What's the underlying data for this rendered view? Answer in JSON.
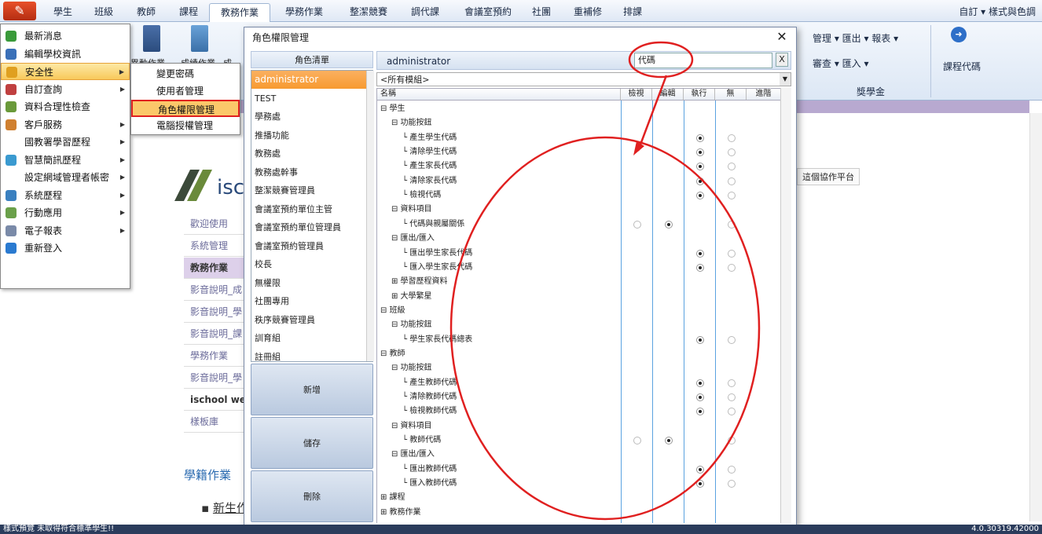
{
  "menubar": {
    "tabs": [
      "學生",
      "班級",
      "教師",
      "課程",
      "教務作業",
      "學務作業",
      "整潔競賽",
      "調代課",
      "會議室預約",
      "社團",
      "重補修",
      "排課"
    ],
    "active_tab": "教務作業",
    "right": "自訂 ▾ 樣式與色調"
  },
  "ribbon": {
    "left_labels": [
      "異動作業",
      "成績作業",
      "成"
    ],
    "right_group": {
      "row1": "管理 ▾ 匯出 ▾ 報表 ▾",
      "row2": "審查 ▾ 匯入 ▾",
      "group_label": "獎學金",
      "course_code": "課程代碼"
    }
  },
  "left_menu": [
    {
      "label": "最新消息",
      "icon": "speech-icon",
      "arrow": false
    },
    {
      "label": "編輯學校資訊",
      "icon": "school-icon",
      "arrow": false
    },
    {
      "label": "安全性",
      "icon": "key-icon",
      "arrow": true,
      "highlight": true
    },
    {
      "label": "自訂查詢",
      "icon": "query-icon",
      "arrow": true
    },
    {
      "label": "資料合理性檢查",
      "icon": "check-icon",
      "arrow": false
    },
    {
      "label": "客戶服務",
      "icon": "person-icon",
      "arrow": true
    },
    {
      "label": "國教署學習歷程",
      "icon": "",
      "arrow": true
    },
    {
      "label": "智慧簡訊歷程",
      "icon": "sms-icon",
      "arrow": true
    },
    {
      "label": "設定網域管理者帳密",
      "icon": "",
      "arrow": true
    },
    {
      "label": "系統歷程",
      "icon": "history-icon",
      "arrow": true
    },
    {
      "label": "行動應用",
      "icon": "mobile-icon",
      "arrow": true
    },
    {
      "label": "電子報表",
      "icon": "report-icon",
      "arrow": true
    },
    {
      "label": "重新登入",
      "icon": "relogin-icon",
      "arrow": false
    }
  ],
  "submenu": [
    "變更密碼",
    "使用者管理",
    "角色權限管理",
    "電腦授權管理"
  ],
  "page": {
    "logo_text": "isc",
    "rows": [
      "歡迎使用",
      "系統管理",
      "教務作業",
      "影音說明_成",
      "影音說明_學",
      "影音說明_課",
      "學務作業",
      "影音說明_學",
      "ischool wel",
      "樣板庫"
    ],
    "section_title": "學籍作業",
    "bullet": "新生作",
    "platform_btn": "這個協作平台"
  },
  "dialog": {
    "title": "角色權限管理",
    "role_header": "角色清單",
    "roles": [
      "administrator",
      "TEST",
      "學務處",
      "推播功能",
      "教務處",
      "教務處幹事",
      "整潔競賽管理員",
      "會議室預約單位主管",
      "會議室預約單位管理員",
      "會議室預約管理員",
      "校長",
      "無權限",
      "社團專用",
      "秩序競賽管理員",
      "訓育組",
      "註冊組"
    ],
    "selected_role": "administrator",
    "buttons": {
      "add": "新增",
      "save": "儲存",
      "delete": "刪除"
    },
    "admin_title": "administrator",
    "search_value": "代碼",
    "search_clear": "X",
    "module_select": "<所有模組>",
    "columns": [
      "名稱",
      "檢視",
      "編輯",
      "執行",
      "無",
      "進階"
    ],
    "tree": [
      {
        "label": "學生",
        "level": 0,
        "sign": "⊟"
      },
      {
        "label": "功能按鈕",
        "level": 1,
        "sign": "⊟"
      },
      {
        "label": "產生學生代碼",
        "level": 2,
        "radios": [
          null,
          null,
          "on",
          "off"
        ]
      },
      {
        "label": "清除學生代碼",
        "level": 2,
        "radios": [
          null,
          null,
          "on",
          "off"
        ]
      },
      {
        "label": "產生家長代碼",
        "level": 2,
        "radios": [
          null,
          null,
          "on",
          "off"
        ]
      },
      {
        "label": "清除家長代碼",
        "level": 2,
        "radios": [
          null,
          null,
          "on",
          "off"
        ]
      },
      {
        "label": "檢視代碼",
        "level": 2,
        "radios": [
          null,
          null,
          "on",
          "off"
        ]
      },
      {
        "label": "資料項目",
        "level": 1,
        "sign": "⊟"
      },
      {
        "label": "代碼與親屬關係",
        "level": 2,
        "radios": [
          "off",
          "on",
          null,
          "off"
        ]
      },
      {
        "label": "匯出/匯入",
        "level": 1,
        "sign": "⊟"
      },
      {
        "label": "匯出學生家長代碼",
        "level": 2,
        "radios": [
          null,
          null,
          "on",
          "off"
        ]
      },
      {
        "label": "匯入學生家長代碼",
        "level": 2,
        "radios": [
          null,
          null,
          "on",
          "off"
        ]
      },
      {
        "label": "學習歷程資料",
        "level": 1,
        "sign": "⊞"
      },
      {
        "label": "大學繁星",
        "level": 1,
        "sign": "⊞"
      },
      {
        "label": "班級",
        "level": 0,
        "sign": "⊟"
      },
      {
        "label": "功能按鈕",
        "level": 1,
        "sign": "⊟"
      },
      {
        "label": "學生家長代碼總表",
        "level": 2,
        "radios": [
          null,
          null,
          "on",
          "off"
        ]
      },
      {
        "label": "教師",
        "level": 0,
        "sign": "⊟"
      },
      {
        "label": "功能按鈕",
        "level": 1,
        "sign": "⊟"
      },
      {
        "label": "產生教師代碼",
        "level": 2,
        "radios": [
          null,
          null,
          "on",
          "off"
        ]
      },
      {
        "label": "清除教師代碼",
        "level": 2,
        "radios": [
          null,
          null,
          "on",
          "off"
        ]
      },
      {
        "label": "檢視教師代碼",
        "level": 2,
        "radios": [
          null,
          null,
          "on",
          "off"
        ]
      },
      {
        "label": "資料項目",
        "level": 1,
        "sign": "⊟"
      },
      {
        "label": "教師代碼",
        "level": 2,
        "radios": [
          "off",
          "on",
          null,
          "off"
        ]
      },
      {
        "label": "匯出/匯入",
        "level": 1,
        "sign": "⊟"
      },
      {
        "label": "匯出教師代碼",
        "level": 2,
        "radios": [
          null,
          null,
          "on",
          "off"
        ]
      },
      {
        "label": "匯入教師代碼",
        "level": 2,
        "radios": [
          null,
          null,
          "on",
          "off"
        ]
      },
      {
        "label": "課程",
        "level": 0,
        "sign": "⊞"
      },
      {
        "label": "教務作業",
        "level": 0,
        "sign": "⊞"
      }
    ]
  },
  "statusbar": {
    "left": "樣式預覽 未取得符合標準學生!!",
    "right": "4.0.30319.42000"
  },
  "colors": {
    "annotation": "#e02020",
    "accent": "#f79a30",
    "purple": "#b8a9d0"
  }
}
